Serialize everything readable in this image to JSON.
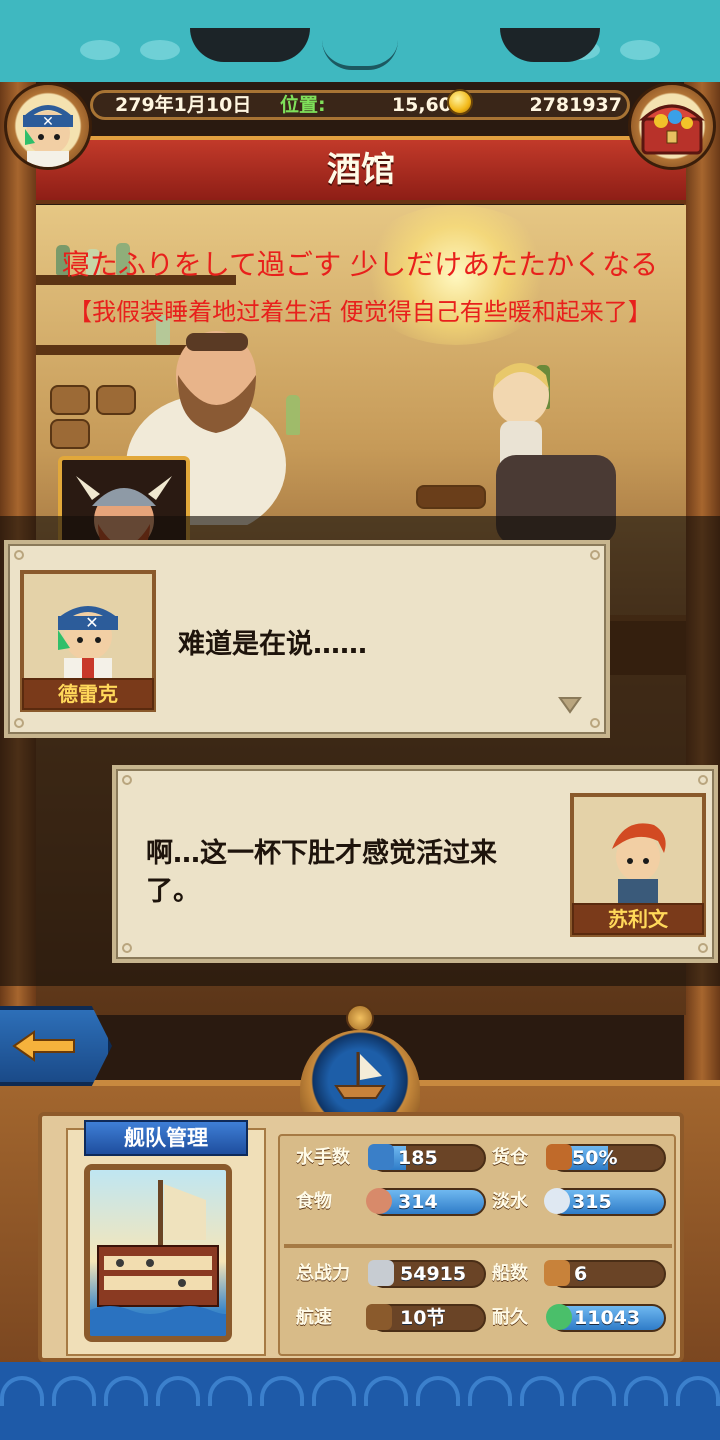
{
  "header": {
    "date": "279年1月10日",
    "location_label": "位置:",
    "location_value": "15,60",
    "gold": "2781937"
  },
  "location_title": "酒馆",
  "subtitles": {
    "japanese": "寝たふりをして過ごす 少しだけあたたかくなる",
    "chinese": "【我假装睡着地过着生活 便觉得自己有些暖和起来了】"
  },
  "dialogs": [
    {
      "speaker": "德雷克",
      "text": "难道是在说……"
    },
    {
      "speaker": "苏利文",
      "text_line1": "啊…这一杯下肚才感觉活过来",
      "text_line2": "了。"
    }
  ],
  "fleet": {
    "title": "舰队管理",
    "stats": [
      {
        "label": "水手数",
        "value": "185",
        "icon": "sailor-icon",
        "fill": 0.3
      },
      {
        "label": "货仓",
        "value": "50%",
        "icon": "cargo-icon",
        "fill": 0.5
      },
      {
        "label": "食物",
        "value": "314",
        "icon": "food-icon",
        "fill": 1.0
      },
      {
        "label": "淡水",
        "value": "315",
        "icon": "water-icon",
        "fill": 1.0
      },
      {
        "label": "总战力",
        "value": "54915",
        "icon": "combat-icon",
        "fill": 0
      },
      {
        "label": "船数",
        "value": "6",
        "icon": "ship-count-icon",
        "fill": 0
      },
      {
        "label": "航速",
        "value": "10节",
        "icon": "speed-icon",
        "fill": 0
      },
      {
        "label": "耐久",
        "value": "11043",
        "icon": "durability-icon",
        "fill": 1.0
      }
    ]
  },
  "colors": {
    "subtitle": "#e8201c",
    "location_label": "#7fe05a",
    "accent_blue": "#2f7cc8"
  }
}
